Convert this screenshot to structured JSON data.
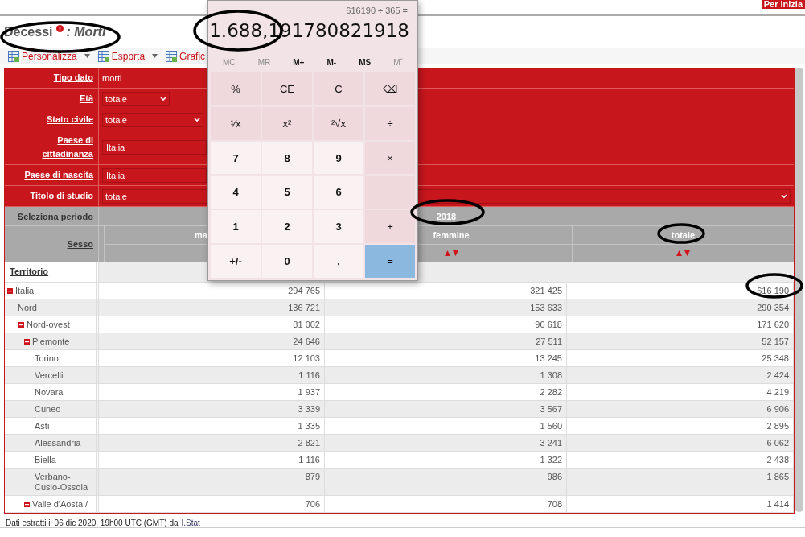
{
  "top_bar": {
    "badge": "Per inizia"
  },
  "title": {
    "main": "Decessi",
    "subtitle": ": Morti"
  },
  "toolbar": [
    {
      "label": "Personalizza",
      "dropdown": true
    },
    {
      "label": "Esporta",
      "dropdown": true
    },
    {
      "label": "Grafic",
      "dropdown": false
    }
  ],
  "filters": [
    {
      "label": "Tipo dato",
      "kind": "text",
      "value": "morti"
    },
    {
      "label": "Età",
      "kind": "select",
      "value": "totale"
    },
    {
      "label": "Stato civile",
      "kind": "select",
      "value": "totale"
    },
    {
      "label": "Paese di cittadinanza",
      "kind": "input",
      "value": "Italia"
    },
    {
      "label": "Paese di nascita",
      "kind": "input",
      "value": "Italia"
    },
    {
      "label": "Titolo di studio",
      "kind": "select_wide",
      "value": "totale"
    }
  ],
  "period": {
    "label": "Seleziona periodo",
    "value": "2018"
  },
  "sex": {
    "label": "Sesso",
    "columns": [
      {
        "label": "ma"
      },
      {
        "label": "femmine"
      },
      {
        "label": "totale"
      }
    ]
  },
  "territory_header": "Territorio",
  "rows": [
    {
      "name": "Italia",
      "expanded": true,
      "values": [
        "294 765",
        "321 425",
        "616 190"
      ],
      "children": [
        {
          "name": "Nord",
          "values": [
            "136 721",
            "153 633",
            "290 354"
          ],
          "children": [
            {
              "name": "Nord-ovest",
              "expanded": true,
              "values": [
                "81 002",
                "90 618",
                "171 620"
              ],
              "children": [
                {
                  "name": "Piemonte",
                  "expanded": true,
                  "values": [
                    "24 646",
                    "27 511",
                    "52 157"
                  ],
                  "children": [
                    {
                      "name": "Torino",
                      "values": [
                        "12 103",
                        "13 245",
                        "25 348"
                      ]
                    },
                    {
                      "name": "Vercelli",
                      "values": [
                        "1 116",
                        "1 308",
                        "2 424"
                      ]
                    },
                    {
                      "name": "Novara",
                      "values": [
                        "1 937",
                        "2 282",
                        "4 219"
                      ]
                    },
                    {
                      "name": "Cuneo",
                      "values": [
                        "3 339",
                        "3 567",
                        "6 906"
                      ]
                    },
                    {
                      "name": "Asti",
                      "values": [
                        "1 335",
                        "1 560",
                        "2 895"
                      ]
                    },
                    {
                      "name": "Alessandria",
                      "values": [
                        "2 821",
                        "3 241",
                        "6 062"
                      ]
                    },
                    {
                      "name": "Biella",
                      "values": [
                        "1 116",
                        "1 322",
                        "2 438"
                      ]
                    },
                    {
                      "name": "Verbano-Cusio-Ossola",
                      "values": [
                        "879",
                        "986",
                        "1 865"
                      ]
                    }
                  ]
                },
                {
                  "name": "Valle d'Aosta /",
                  "expanded": true,
                  "values": [
                    "706",
                    "708",
                    "1 414"
                  ]
                }
              ]
            }
          ]
        }
      ]
    }
  ],
  "footer": {
    "text": "Dati estratti il 06 dic 2020, 19h00 UTC (GMT) da",
    "link": "I.Stat"
  },
  "calculator": {
    "expression": "616190 ÷ 365 =",
    "display": "1.688,191780821918",
    "memory": [
      {
        "label": "MC",
        "disabled": true
      },
      {
        "label": "MR",
        "disabled": true
      },
      {
        "label": "M+",
        "disabled": false
      },
      {
        "label": "M-",
        "disabled": false
      },
      {
        "label": "MS",
        "disabled": false
      },
      {
        "label": "Mˇ",
        "disabled": true
      }
    ],
    "keys": [
      {
        "label": "%",
        "kind": "op"
      },
      {
        "label": "CE",
        "kind": "op"
      },
      {
        "label": "C",
        "kind": "op"
      },
      {
        "label": "⌫",
        "kind": "op"
      },
      {
        "label": "¹⁄x",
        "kind": "op"
      },
      {
        "label": "x²",
        "kind": "op"
      },
      {
        "label": "²√x",
        "kind": "op"
      },
      {
        "label": "÷",
        "kind": "op"
      },
      {
        "label": "7",
        "kind": "digit"
      },
      {
        "label": "8",
        "kind": "digit"
      },
      {
        "label": "9",
        "kind": "digit"
      },
      {
        "label": "×",
        "kind": "op"
      },
      {
        "label": "4",
        "kind": "digit"
      },
      {
        "label": "5",
        "kind": "digit"
      },
      {
        "label": "6",
        "kind": "digit"
      },
      {
        "label": "−",
        "kind": "op"
      },
      {
        "label": "1",
        "kind": "digit"
      },
      {
        "label": "2",
        "kind": "digit"
      },
      {
        "label": "3",
        "kind": "digit"
      },
      {
        "label": "+",
        "kind": "op"
      },
      {
        "label": "+/-",
        "kind": "digit"
      },
      {
        "label": "0",
        "kind": "digit"
      },
      {
        "label": ",",
        "kind": "digit"
      },
      {
        "label": "=",
        "kind": "equals"
      }
    ]
  }
}
